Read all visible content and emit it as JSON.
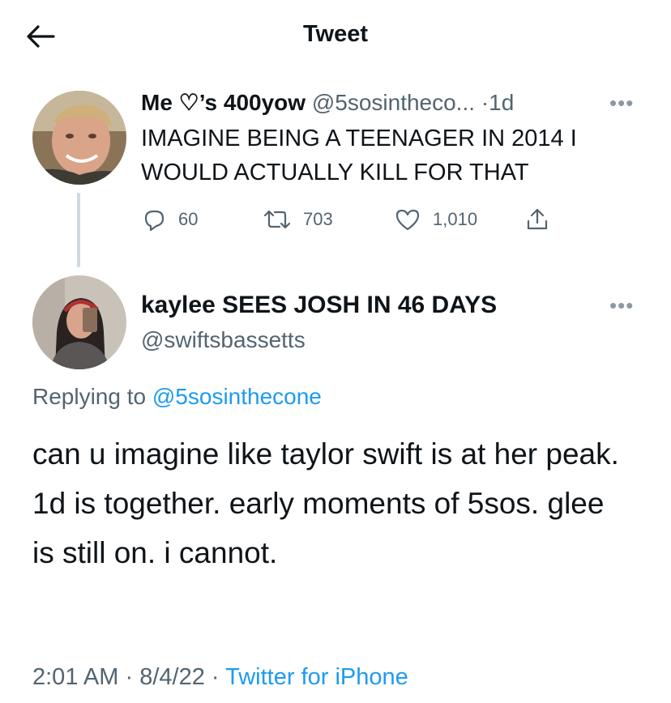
{
  "header": {
    "title": "Tweet",
    "back_icon": "arrow-left-icon"
  },
  "original_tweet": {
    "display_name": "Me ♡’s 400yow",
    "handle": "@5sosintheco...",
    "separator": "·",
    "age": "1d",
    "more_icon": "more-dots-icon",
    "text": "IMAGINE BEING A TEENAGER IN 2014 I WOULD ACTUALLY KILL FOR THAT",
    "stats": {
      "replies": "60",
      "retweets": "703",
      "likes": "1,010"
    }
  },
  "reply_tweet": {
    "display_name": "kaylee SEES JOSH IN 46 DAYS",
    "handle": "@swiftsbassetts",
    "more_icon": "more-dots-icon",
    "replying_label": "Replying to",
    "replying_to": "@5sosinthecone",
    "text": "can u imagine like taylor swift is at her peak. 1d is together. early moments of 5sos. glee is still on. i cannot.",
    "time": "2:01 AM",
    "dot1": "·",
    "date": "8/4/22",
    "dot2": "·",
    "source": "Twitter for iPhone"
  },
  "colors": {
    "link": "#1d9bf0",
    "secondary": "#536471",
    "text": "#0f1419",
    "thread_line": "#cfd9de"
  }
}
